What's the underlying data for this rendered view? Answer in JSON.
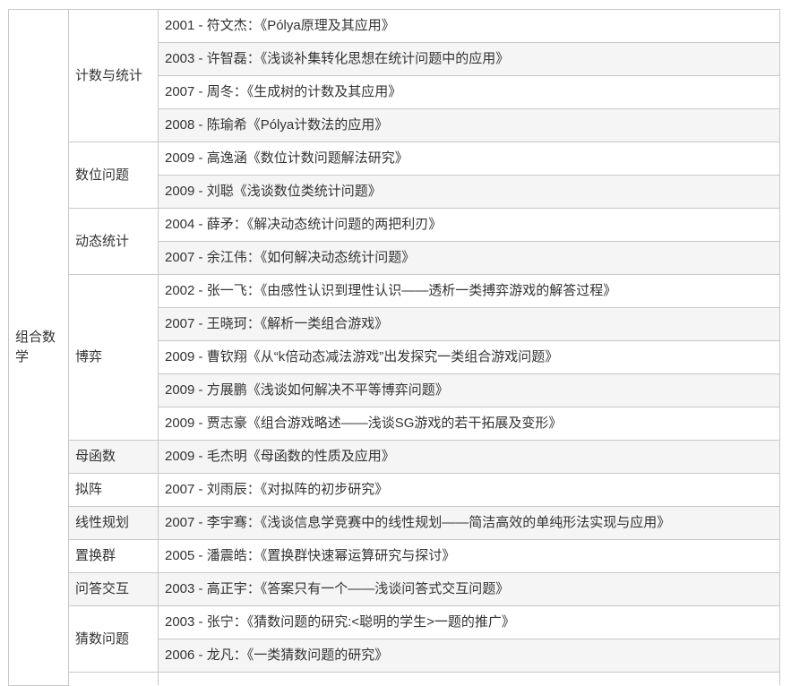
{
  "table": {
    "area": "组合数学",
    "groups": [
      {
        "category": "计数与统计",
        "papers": [
          "2001 - 符文杰：《Pólya原理及其应用》",
          "2003 - 许智磊：《浅谈补集转化思想在统计问题中的应用》",
          "2007 - 周冬：《生成树的计数及其应用》",
          "2008 - 陈瑜希《Pólya计数法的应用》"
        ]
      },
      {
        "category": "数位问题",
        "papers": [
          "2009 - 高逸涵《数位计数问题解法研究》",
          "2009 - 刘聪《浅谈数位类统计问题》"
        ]
      },
      {
        "category": "动态统计",
        "papers": [
          "2004 - 薛矛：《解决动态统计问题的两把利刃》",
          "2007 - 余江伟：《如何解决动态统计问题》"
        ]
      },
      {
        "category": "博弈",
        "papers": [
          "2002 - 张一飞：《由感性认识到理性认识——透析一类搏弈游戏的解答过程》",
          "2007 - 王晓珂：《解析一类组合游戏》",
          "2009 - 曹钦翔《从“k倍动态减法游戏”出发探究一类组合游戏问题》",
          "2009 - 方展鹏《浅谈如何解决不平等博弈问题》",
          "2009 - 贾志豪《组合游戏略述——浅谈SG游戏的若干拓展及变形》"
        ]
      },
      {
        "category": "母函数",
        "papers": [
          "2009 - 毛杰明《母函数的性质及应用》"
        ]
      },
      {
        "category": "拟阵",
        "papers": [
          "2007 - 刘雨辰：《对拟阵的初步研究》"
        ]
      },
      {
        "category": "线性规划",
        "papers": [
          "2007 - 李宇骞：《浅谈信息学竞赛中的线性规划——简洁高效的单纯形法实现与应用》"
        ]
      },
      {
        "category": "置换群",
        "papers": [
          "2005 - 潘震皓：《置换群快速幂运算研究与探讨》"
        ]
      },
      {
        "category": "问答交互",
        "papers": [
          "2003 - 高正宇：《答案只有一个——浅谈问答式交互问题》"
        ]
      },
      {
        "category": "猜数问题",
        "papers": [
          "2003 - 张宁：《猜数问题的研究:<聪明的学生>一题的推广》",
          "2006 - 龙凡：《一类猜数问题的研究》"
        ]
      }
    ]
  }
}
